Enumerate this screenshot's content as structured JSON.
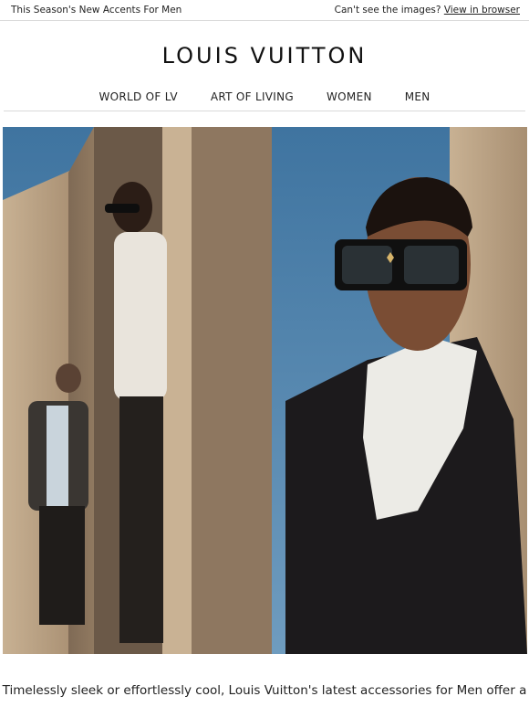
{
  "preheader": {
    "left_text": "This Season's New Accents For Men",
    "right_text": "Can't see the images?",
    "right_link": "View in browser"
  },
  "brand": {
    "logo_text": "LOUIS VUITTON"
  },
  "nav": {
    "items": [
      {
        "label": "WORLD OF LV"
      },
      {
        "label": "ART OF LIVING"
      },
      {
        "label": "WOMEN"
      },
      {
        "label": "MEN"
      }
    ]
  },
  "hero": {
    "sky_color": "#4d82aa",
    "pillar_color": "#b49c80"
  },
  "body": {
    "caption": "Timelessly sleek or effortlessly cool, Louis Vuitton's latest accessories for Men offer a"
  }
}
